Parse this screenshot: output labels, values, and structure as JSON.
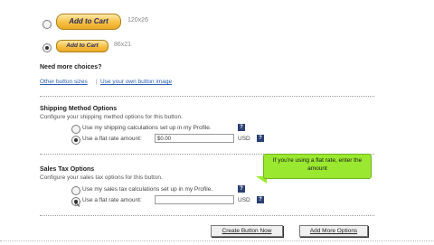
{
  "buttons_section": {
    "large_button_label": "Add to Cart",
    "large_button_size": "120x26",
    "small_button_label": "Add to Cart",
    "small_button_size": "86x21",
    "more_choices_heading": "Need more choices?",
    "other_sizes_link": "Other button sizes",
    "divider": "|",
    "own_image_link": "Use your own button image"
  },
  "shipping": {
    "heading": "Shipping Method Options",
    "subtext": "Configure your shipping method options for this button.",
    "option_profile": "Use my shipping calculations set up in my Profile.",
    "option_flat": "Use a flat rate amount:",
    "flat_value": "$0.00",
    "currency": "USD"
  },
  "tax": {
    "heading": "Sales Tax Options",
    "subtext": "Configure your sales tax options for this button.",
    "option_profile": "Use my sales tax calculations set up in my Profile.",
    "option_flat": "Use a flat rate amount:",
    "flat_value": "",
    "currency": "USD"
  },
  "tooltip": {
    "text": "If you're using a flat rate, enter the amount"
  },
  "actions": {
    "create_button": "Create Button Now",
    "add_more_options": "Add More Options"
  },
  "help_glyph": "?"
}
